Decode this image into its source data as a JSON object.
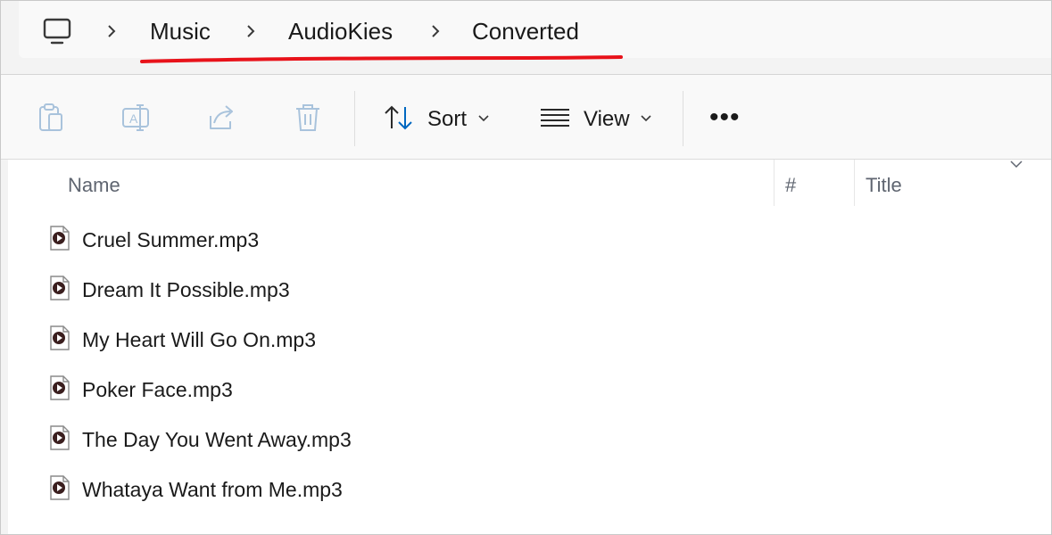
{
  "breadcrumb": {
    "items": [
      "Music",
      "AudioKies",
      "Converted"
    ]
  },
  "toolbar": {
    "sort_label": "Sort",
    "view_label": "View",
    "more_label": "•••"
  },
  "columns": {
    "name": "Name",
    "number": "#",
    "title": "Title"
  },
  "files": [
    {
      "name": "Cruel Summer.mp3"
    },
    {
      "name": "Dream It Possible.mp3"
    },
    {
      "name": "My Heart Will Go On.mp3"
    },
    {
      "name": "Poker Face.mp3"
    },
    {
      "name": "The Day You Went Away.mp3"
    },
    {
      "name": "Whataya Want from Me.mp3"
    }
  ],
  "colors": {
    "annotation_underline": "#e8121a",
    "accent": "#0067c0",
    "disabled_icon": "#a9c3dc"
  },
  "icons": {
    "pc": "computer-icon",
    "paste": "paste-icon",
    "rename": "rename-icon",
    "share": "share-icon",
    "delete": "delete-icon",
    "sort": "sort-icon",
    "view": "view-icon",
    "more": "more-icon",
    "file": "audio-file-icon"
  }
}
